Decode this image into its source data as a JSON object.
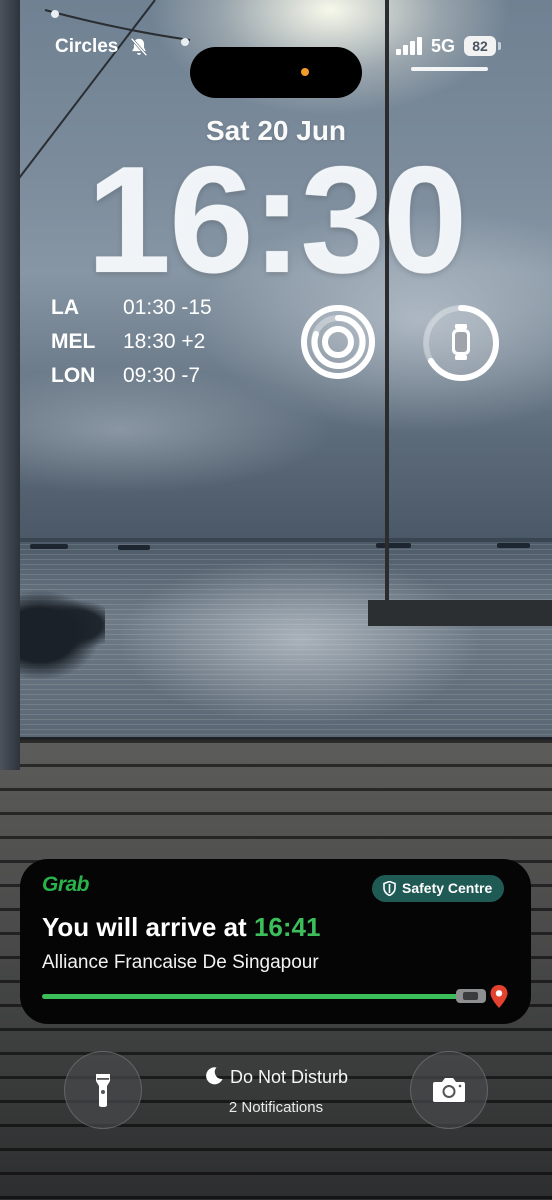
{
  "status_bar": {
    "carrier": "Circles",
    "silent_icon": "bell-slash-icon",
    "network": "5G",
    "battery": "82",
    "privacy_indicator_color": "#f39c29"
  },
  "lock_screen": {
    "date": "Sat 20 Jun",
    "time": "16:30"
  },
  "world_clock": [
    {
      "city": "LA",
      "time": "01:30 -15"
    },
    {
      "city": "MEL",
      "time": "18:30 +2"
    },
    {
      "city": "LON",
      "time": "09:30 -7"
    }
  ],
  "widgets": {
    "activity_icon": "activity-rings-icon",
    "watch_icon": "watch-battery-icon"
  },
  "live_activity": {
    "app": "Grab",
    "safety_label": "Safety Centre",
    "arrive_prefix": "You will arrive at ",
    "eta": "16:41",
    "destination": "Alliance Francaise De Singapour",
    "progress": 0.97,
    "brand_color": "#2ab24b"
  },
  "bottom": {
    "flashlight_icon": "flashlight-icon",
    "focus_label": "Do Not Disturb",
    "notifications": "2 Notifications",
    "camera_icon": "camera-icon"
  }
}
